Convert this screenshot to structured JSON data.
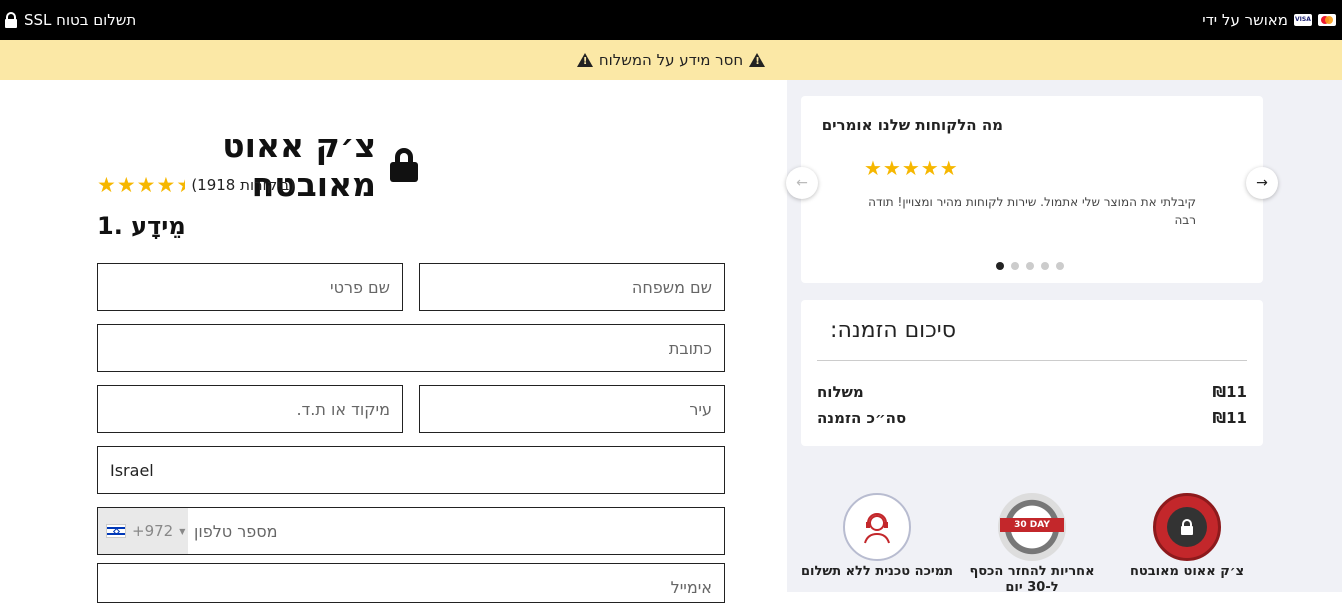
{
  "topbar": {
    "secure_label": "SSL תשלום בטוח",
    "approved_label": "מאושר על ידי",
    "card_icons": [
      "visa-icon",
      "mastercard-icon"
    ],
    "bg_color": "#000000"
  },
  "warning": {
    "text": "חסר מידע על המשלוח",
    "bg_color": "#fbe8a6"
  },
  "checkout": {
    "title": "צ׳ק אאוט מאובטח",
    "rating_stars": 4.5,
    "reviews_text": "(ביקורות 1918)",
    "section_title": "מֵידָע .1"
  },
  "form": {
    "first_name_placeholder": "שם פרטי",
    "last_name_placeholder": "שם משפחה",
    "address_placeholder": "כתובת",
    "zip_placeholder": "מיקוד או ת.ד.",
    "city_placeholder": "עיר",
    "country_value": "Israel",
    "phone_code": "+972",
    "phone_placeholder": "מספר טלפון",
    "email_placeholder": "אימייל"
  },
  "reviews": {
    "title": "מה הלקוחות שלנו אומרים",
    "stars": "★★★★★",
    "text": "קיבלתי את המוצר שלי אתמול. שירות לקוחות מהיר ומצויין! תודה רבה",
    "prev_glyph": "←",
    "next_glyph": "→",
    "dot_count": 5,
    "active_dot": 1
  },
  "summary": {
    "title": "סיכום הזמנה:",
    "shipping_label": "משלוח",
    "shipping_value": "₪11",
    "total_label": "סה״כ הזמנה",
    "total_value": "₪11"
  },
  "badges": {
    "support_label": "תמיכה טכנית ללא תשלום",
    "money_back_label": "אחריות להחזר הכסף ל-30 יום",
    "money_back_ribbon": "30 DAY",
    "secure_label": "צ׳ק אאוט מאובטח"
  }
}
